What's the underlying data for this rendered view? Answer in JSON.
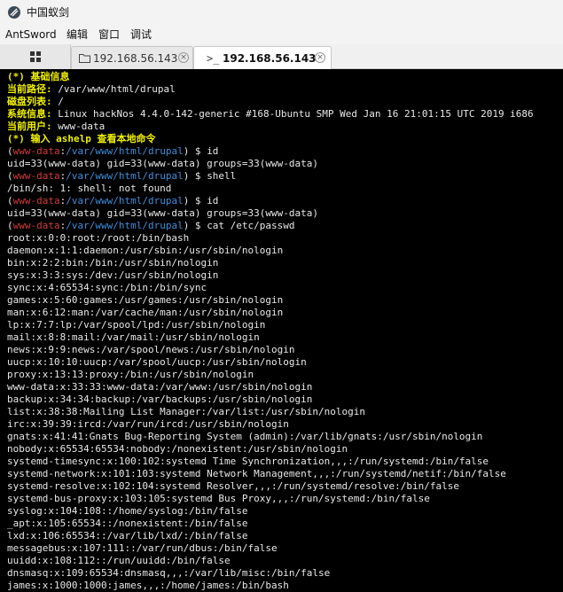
{
  "window": {
    "title": "中国蚁剑",
    "app_icon": "antsword-logo-icon"
  },
  "menu": [
    "AntSword",
    "编辑",
    "窗口",
    "调试"
  ],
  "tabs": [
    {
      "label": "192.168.56.143",
      "icon": "folder-icon",
      "active": false
    },
    {
      "label": "192.168.56.143",
      "icon": "terminal-icon",
      "active": true
    }
  ],
  "terminal": {
    "info_header": "(*) 基础信息",
    "info": [
      {
        "label": "当前路径:",
        "value": " /var/www/html/drupal"
      },
      {
        "label": "磁盘列表:",
        "value": " /"
      },
      {
        "label": "系统信息:",
        "value": " Linux hackNos 4.4.0-142-generic #168-Ubuntu SMP Wed Jan 16 21:01:15 UTC 2019 i686"
      },
      {
        "label": "当前用户:",
        "value": " www-data"
      }
    ],
    "hint": "(*) 输入 ashelp 查看本地命令",
    "prompt": {
      "open": "(",
      "user": "www-data",
      "sep": ":",
      "path": "/var/www/html/drupal",
      "close": ") $ "
    },
    "commands": [
      {
        "cmd": "id",
        "output": [
          "uid=33(www-data) gid=33(www-data) groups=33(www-data)"
        ]
      },
      {
        "cmd": "shell",
        "output": [
          "/bin/sh: 1: shell: not found"
        ]
      },
      {
        "cmd": "id",
        "output": [
          "uid=33(www-data) gid=33(www-data) groups=33(www-data)"
        ]
      },
      {
        "cmd": "cat /etc/passwd",
        "output": [
          "root:x:0:0:root:/root:/bin/bash",
          "daemon:x:1:1:daemon:/usr/sbin:/usr/sbin/nologin",
          "bin:x:2:2:bin:/bin:/usr/sbin/nologin",
          "sys:x:3:3:sys:/dev:/usr/sbin/nologin",
          "sync:x:4:65534:sync:/bin:/bin/sync",
          "games:x:5:60:games:/usr/games:/usr/sbin/nologin",
          "man:x:6:12:man:/var/cache/man:/usr/sbin/nologin",
          "lp:x:7:7:lp:/var/spool/lpd:/usr/sbin/nologin",
          "mail:x:8:8:mail:/var/mail:/usr/sbin/nologin",
          "news:x:9:9:news:/var/spool/news:/usr/sbin/nologin",
          "uucp:x:10:10:uucp:/var/spool/uucp:/usr/sbin/nologin",
          "proxy:x:13:13:proxy:/bin:/usr/sbin/nologin",
          "www-data:x:33:33:www-data:/var/www:/usr/sbin/nologin",
          "backup:x:34:34:backup:/var/backups:/usr/sbin/nologin",
          "list:x:38:38:Mailing List Manager:/var/list:/usr/sbin/nologin",
          "irc:x:39:39:ircd:/var/run/ircd:/usr/sbin/nologin",
          "gnats:x:41:41:Gnats Bug-Reporting System (admin):/var/lib/gnats:/usr/sbin/nologin",
          "nobody:x:65534:65534:nobody:/nonexistent:/usr/sbin/nologin",
          "systemd-timesync:x:100:102:systemd Time Synchronization,,,:/run/systemd:/bin/false",
          "systemd-network:x:101:103:systemd Network Management,,,:/run/systemd/netif:/bin/false",
          "systemd-resolve:x:102:104:systemd Resolver,,,:/run/systemd/resolve:/bin/false",
          "systemd-bus-proxy:x:103:105:systemd Bus Proxy,,,:/run/systemd:/bin/false",
          "syslog:x:104:108::/home/syslog:/bin/false",
          "_apt:x:105:65534::/nonexistent:/bin/false",
          "lxd:x:106:65534::/var/lib/lxd/:/bin/false",
          "messagebus:x:107:111::/var/run/dbus:/bin/false",
          "uuidd:x:108:112::/run/uuidd:/bin/false",
          "dnsmasq:x:109:65534:dnsmasq,,,:/var/lib/misc:/bin/false",
          "james:x:1000:1000:james,,,:/home/james:/bin/bash"
        ]
      }
    ]
  },
  "colors": {
    "info": "#f0f000",
    "prompt_user": "#d63a3a",
    "prompt_path": "#3e8fdc",
    "text": "#e8e8e8",
    "background": "#000000"
  }
}
